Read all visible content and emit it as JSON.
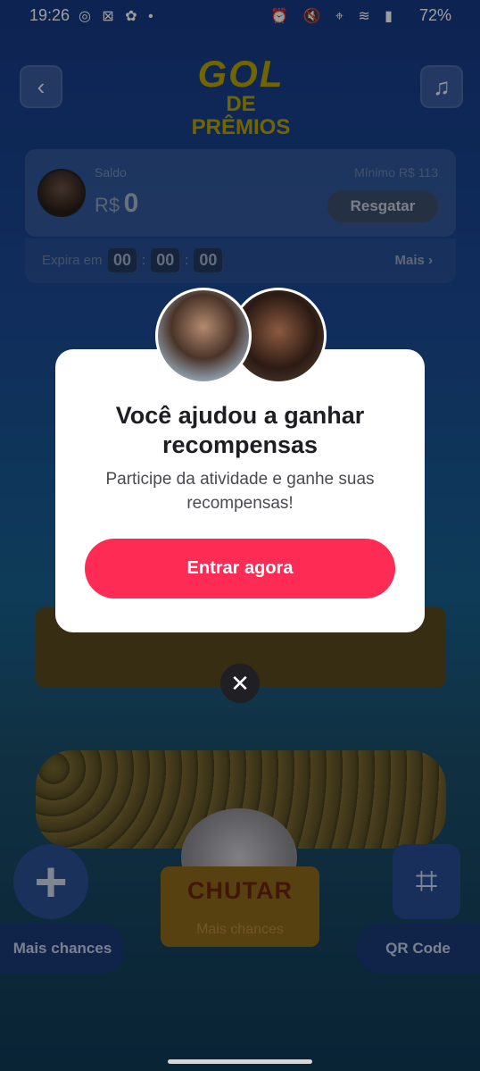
{
  "status_bar": {
    "time": "19:26",
    "left_icons": "◎ ⊠ ✿ •",
    "right_icons": "⏰ 🔇 ⌖ ≋ ▮",
    "battery": "72%"
  },
  "header": {
    "back_glyph": "‹",
    "music_glyph": "♫",
    "logo_line1": "GOL",
    "logo_line2": "DE PRÊMIOS"
  },
  "balance": {
    "saldo_label": "Saldo",
    "currency": "R$",
    "amount": "0",
    "minimo": "Mínimo  R$ 113",
    "redeem_label": "Resgatar"
  },
  "expiry": {
    "label": "Expira em",
    "hours": "00",
    "minutes": "00",
    "seconds": "00",
    "sep": ":",
    "more_label": "Mais ›"
  },
  "game": {
    "plus_glyph": "+",
    "qr_glyph": "⌗",
    "chutar_label": "CHUTAR",
    "chutar_sub": "Mais chances",
    "more_chances_label": "Mais chances",
    "qr_code_label": "QR Code"
  },
  "modal": {
    "title": "Você ajudou  a ganhar\nrecompensas",
    "body": "Participe da atividade e ganhe suas recompensas!",
    "cta_label": "Entrar agora",
    "close_glyph": "✕"
  },
  "colors": {
    "cta": "#fe2c55",
    "modal_bg": "#ffffff"
  }
}
